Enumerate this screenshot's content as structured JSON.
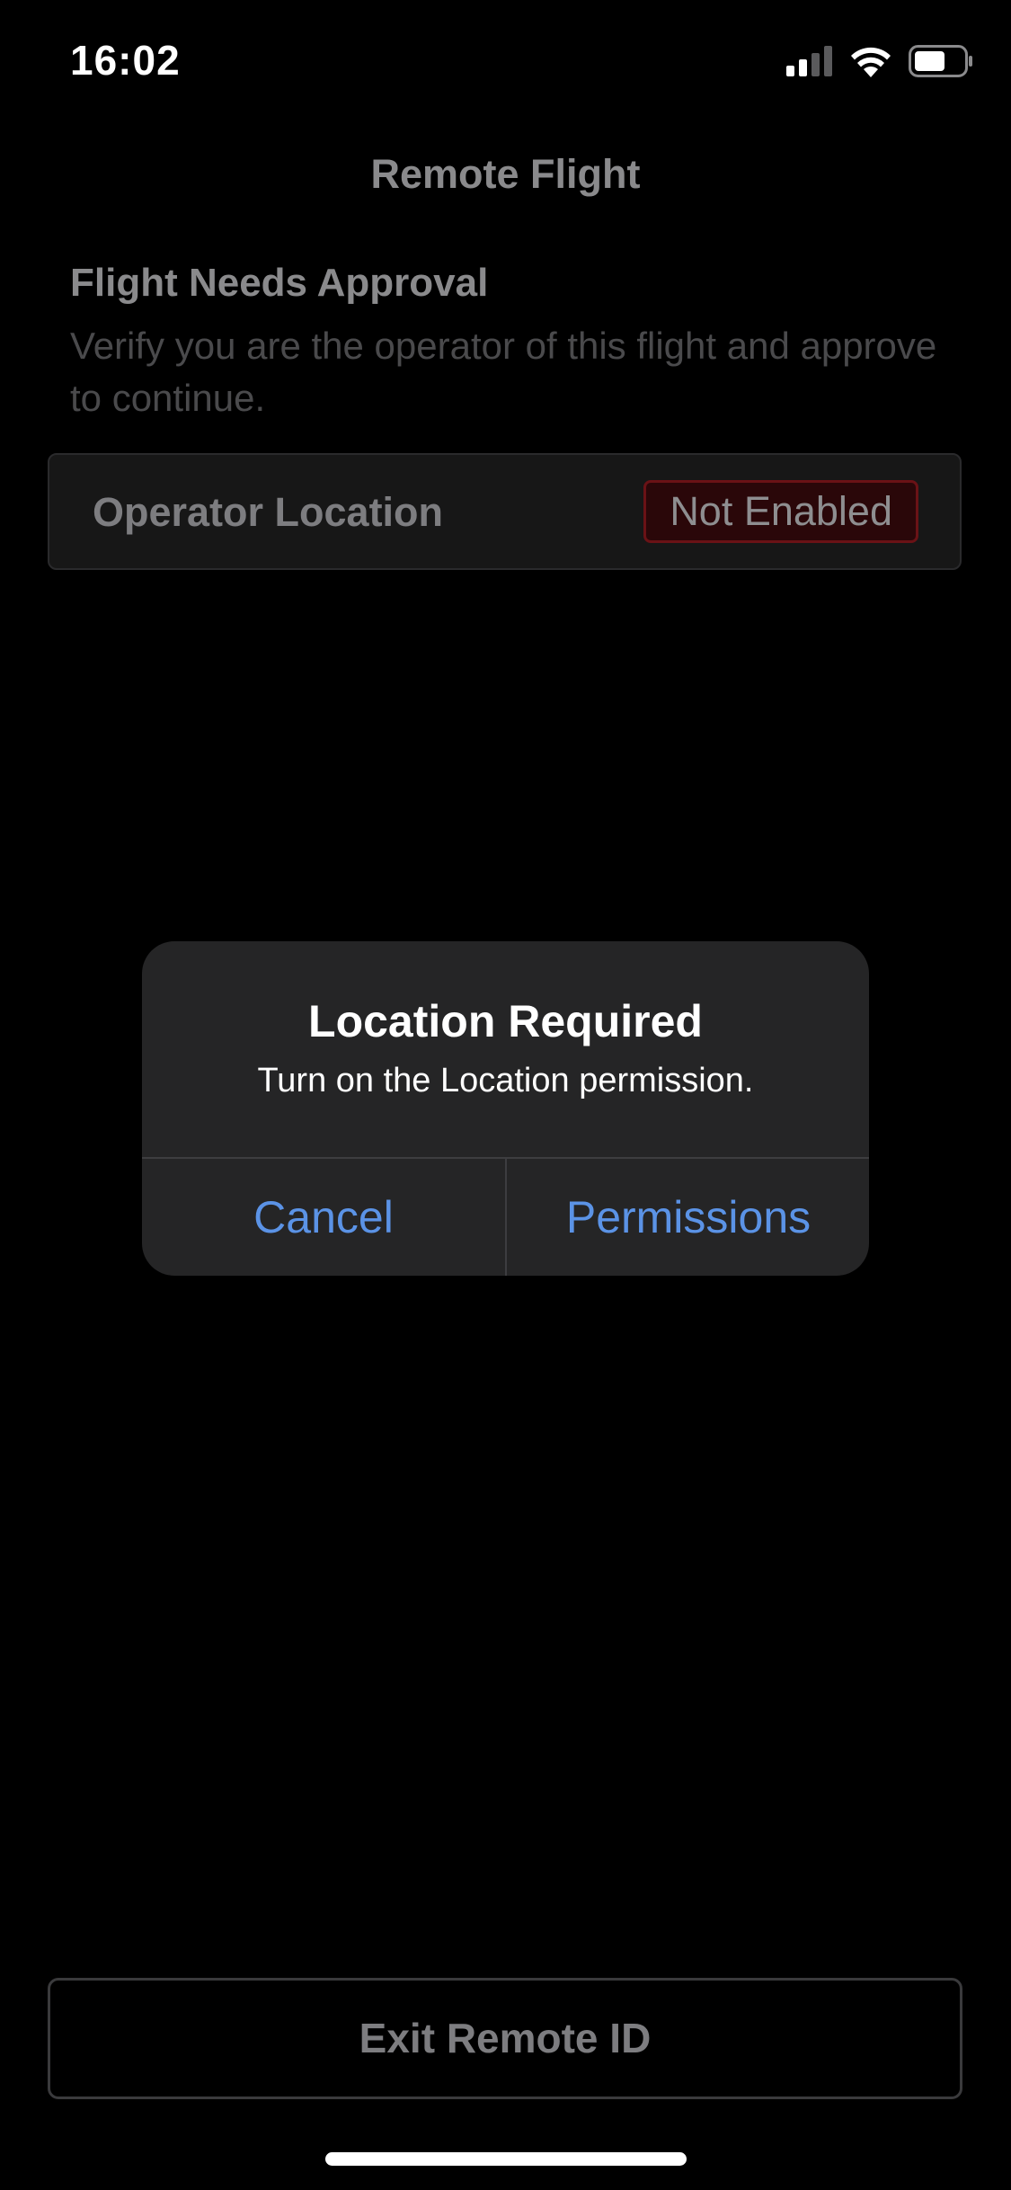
{
  "status_bar": {
    "time": "16:02",
    "signal_icon": "cellular-signal-icon",
    "wifi_icon": "wifi-icon",
    "battery_icon": "battery-icon"
  },
  "nav": {
    "title": "Remote Flight"
  },
  "approval": {
    "heading": "Flight Needs Approval",
    "description": "Verify you are the operator of this flight and approve to continue."
  },
  "operator_location": {
    "label": "Operator Location",
    "status": "Not Enabled"
  },
  "dialog": {
    "title": "Location Required",
    "message": "Turn on the Location permission.",
    "cancel_label": "Cancel",
    "permissions_label": "Permissions"
  },
  "footer": {
    "exit_label": "Exit Remote ID"
  },
  "colors": {
    "background": "#000000",
    "dialog": "#252526",
    "accent_blue": "#5b93e6",
    "badge_red": "#6a1216"
  }
}
